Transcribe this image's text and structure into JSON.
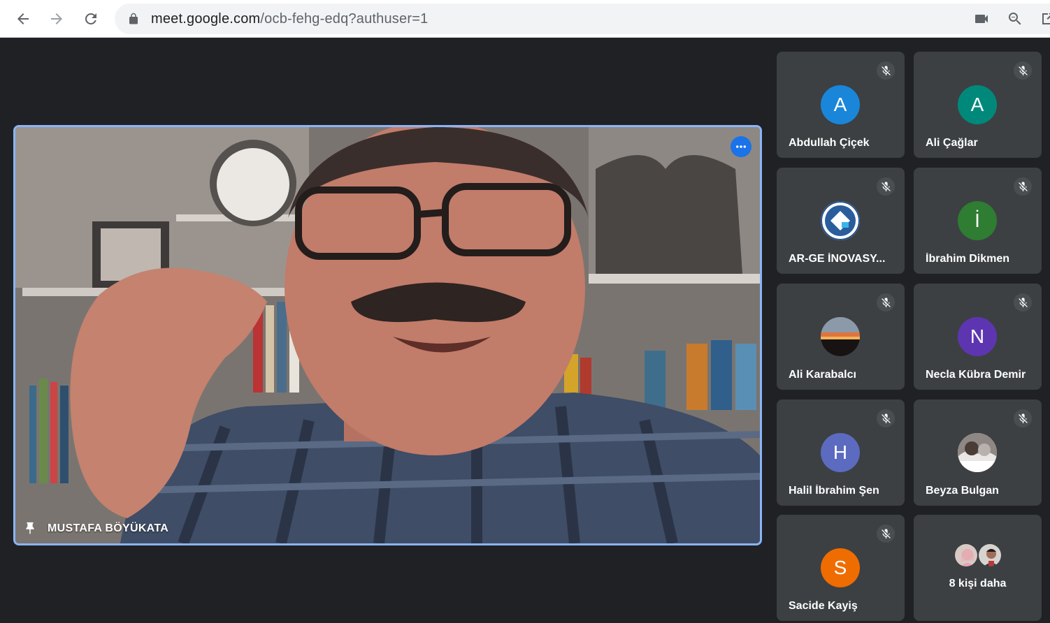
{
  "browser": {
    "url_host": "meet.google.com",
    "url_path": "/ocb-fehg-edq?authuser=1"
  },
  "meeting": {
    "main_speaker": {
      "name": "MUSTAFA BÖYÜKATA"
    }
  },
  "participants": [
    {
      "name": "Abdullah Çiçek",
      "initial": "A",
      "color": "#1a86d9",
      "muted": true
    },
    {
      "name": "Ali Çağlar",
      "initial": "A",
      "color": "#00897b",
      "muted": true
    },
    {
      "name": "AR-GE İNOVASY...",
      "initial": "",
      "color": "#ffffff",
      "muted": true
    },
    {
      "name": "İbrahim Dikmen",
      "initial": "İ",
      "color": "#2e7d32",
      "muted": true
    },
    {
      "name": "Ali Karabalcı",
      "initial": "",
      "color": "#5b4b49",
      "muted": true
    },
    {
      "name": "Necla Kübra Demir",
      "initial": "N",
      "color": "#5e35b1",
      "muted": true
    },
    {
      "name": "Halil İbrahim Şen",
      "initial": "H",
      "color": "#5c6bc0",
      "muted": true
    },
    {
      "name": "Beyza Bulgan",
      "initial": "",
      "color": "#c8c4c2",
      "muted": true
    },
    {
      "name": "Sacide Kayiş",
      "initial": "S",
      "color": "#ef6c00",
      "muted": true
    }
  ],
  "more_people": {
    "label": "8 kişi daha"
  }
}
